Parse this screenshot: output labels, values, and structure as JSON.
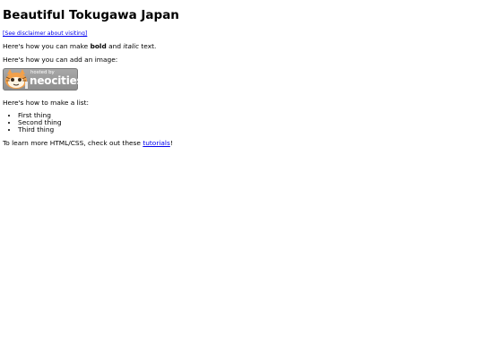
{
  "page": {
    "title": "Beautiful Tokugawa Japan",
    "disclaimer_link": "[See disclaimer about visiting]",
    "format_prefix": "Here's how you can make ",
    "bold_word": "bold",
    "format_middle": " and ",
    "italic_word": "italic",
    "format_suffix": " text.",
    "image_line": "Here's how you can add an image:",
    "badge": {
      "small_text": "hosted by",
      "big_text": "neocities",
      "icon": "neocities-cat-icon"
    },
    "list_intro": "Here's how to make a list:",
    "list_items": [
      "First thing",
      "Second thing",
      "Third thing"
    ],
    "learn_prefix": "To learn more HTML/CSS, check out these ",
    "learn_link": "tutorials",
    "learn_suffix": "!"
  }
}
